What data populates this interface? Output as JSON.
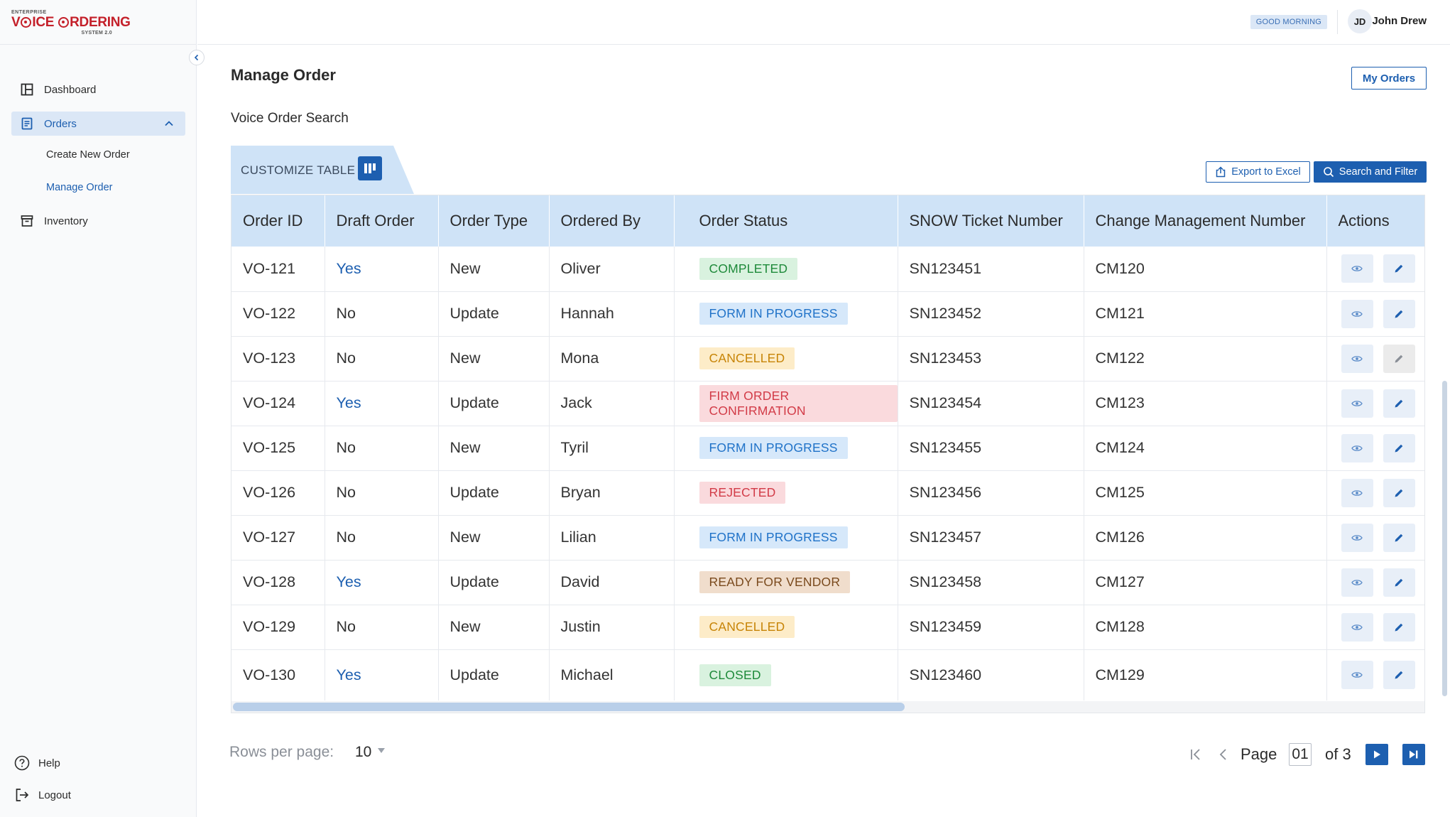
{
  "app": {
    "logo_top": "ENTERPRISE",
    "logo_main_before": "V",
    "logo_main_after": "ICE ",
    "logo_main_o2": "RDERING",
    "logo_sub": "SYSTEM 2.0"
  },
  "header": {
    "greeting": "GOOD MORNING",
    "user_initials": "JD",
    "user_name": "John Drew"
  },
  "sidebar": {
    "dashboard": "Dashboard",
    "orders": "Orders",
    "create_new_order": "Create New Order",
    "manage_order": "Manage Order",
    "inventory": "Inventory",
    "help": "Help",
    "logout": "Logout"
  },
  "main": {
    "title": "Manage Order",
    "my_orders_label": "My Orders",
    "section_title": "Voice Order Search",
    "customize_table_label": "CUSTOMIZE TABLE",
    "export_label": "Export to Excel",
    "search_filter_label": "Search and Filter"
  },
  "table": {
    "columns": [
      "Order ID",
      "Draft Order",
      "Order Type",
      "Ordered By",
      "Order Status",
      "SNOW Ticket Number",
      "Change Management Number",
      "Actions"
    ],
    "rows": [
      {
        "id": "VO-121",
        "draft": "Yes",
        "type": "New",
        "by": "Oliver",
        "status": "COMPLETED",
        "snow": "SN123451",
        "cm": "CM120",
        "edit_enabled": true
      },
      {
        "id": "VO-122",
        "draft": "No",
        "type": "Update",
        "by": "Hannah",
        "status": "FORM IN PROGRESS",
        "snow": "SN123452",
        "cm": "CM121",
        "edit_enabled": true
      },
      {
        "id": "VO-123",
        "draft": "No",
        "type": "New",
        "by": "Mona",
        "status": "CANCELLED",
        "snow": "SN123453",
        "cm": "CM122",
        "edit_enabled": false
      },
      {
        "id": "VO-124",
        "draft": "Yes",
        "type": "Update",
        "by": "Jack",
        "status": "FIRM ORDER CONFIRMATION",
        "snow": "SN123454",
        "cm": "CM123",
        "edit_enabled": true
      },
      {
        "id": "VO-125",
        "draft": "No",
        "type": "New",
        "by": "Tyril",
        "status": "FORM IN PROGRESS",
        "snow": "SN123455",
        "cm": "CM124",
        "edit_enabled": true
      },
      {
        "id": "VO-126",
        "draft": "No",
        "type": "Update",
        "by": "Bryan",
        "status": "REJECTED",
        "snow": "SN123456",
        "cm": "CM125",
        "edit_enabled": true
      },
      {
        "id": "VO-127",
        "draft": "No",
        "type": "New",
        "by": "Lilian",
        "status": "FORM IN PROGRESS",
        "snow": "SN123457",
        "cm": "CM126",
        "edit_enabled": true
      },
      {
        "id": "VO-128",
        "draft": "Yes",
        "type": "Update",
        "by": "David",
        "status": "READY FOR VENDOR",
        "snow": "SN123458",
        "cm": "CM127",
        "edit_enabled": true
      },
      {
        "id": "VO-129",
        "draft": "No",
        "type": "New",
        "by": "Justin",
        "status": "CANCELLED",
        "snow": "SN123459",
        "cm": "CM128",
        "edit_enabled": true
      },
      {
        "id": "VO-130",
        "draft": "Yes",
        "type": "Update",
        "by": "Michael",
        "status": "CLOSED",
        "snow": "SN123460",
        "cm": "CM129",
        "edit_enabled": true
      }
    ]
  },
  "status_colors": {
    "COMPLETED": {
      "bg": "#d9f2df",
      "fg": "#1e8a3a"
    },
    "CLOSED": {
      "bg": "#d9f2df",
      "fg": "#1e8a3a"
    },
    "FORM IN PROGRESS": {
      "bg": "#d6e8fa",
      "fg": "#1f72c8"
    },
    "CANCELLED": {
      "bg": "#fdecc8",
      "fg": "#c78407"
    },
    "FIRM ORDER CONFIRMATION": {
      "bg": "#fadadd",
      "fg": "#d23b47"
    },
    "REJECTED": {
      "bg": "#fadadd",
      "fg": "#d23b47"
    },
    "READY FOR VENDOR": {
      "bg": "#f0ddcc",
      "fg": "#7a4a1d"
    }
  },
  "pagination": {
    "rows_per_page_label": "Rows per page:",
    "rows_per_page_value": "10",
    "page_label": "Page",
    "current_page": "01",
    "of_label": "of 3"
  },
  "colors": {
    "accent": "#1d5fb0",
    "header_bg": "#cfe3f7",
    "brand_red": "#c4202a"
  }
}
